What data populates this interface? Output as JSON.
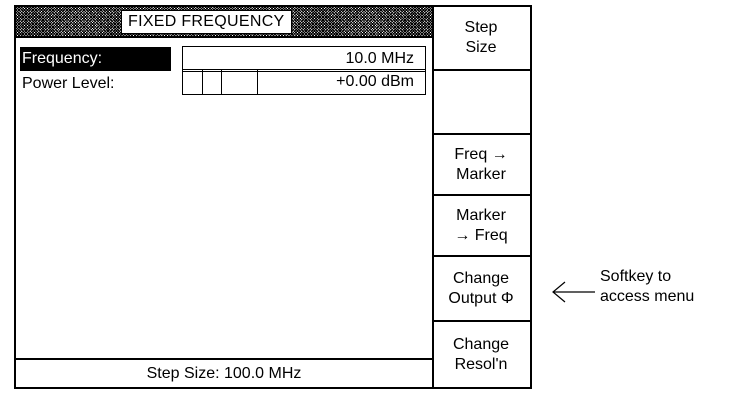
{
  "display": {
    "title": "FIXED FREQUENCY",
    "fields": [
      {
        "label": "Frequency:",
        "value": "10.0 MHz",
        "selected": true
      },
      {
        "label": "Power Level:",
        "value": "+0.00 dBm",
        "selected": false
      }
    ],
    "status": "Step Size: 100.0 MHz"
  },
  "softkeys": [
    {
      "line1": "Step",
      "line2": "Size"
    },
    {
      "line1": "",
      "line2": ""
    },
    {
      "line1": "Freq →",
      "line2": "Marker"
    },
    {
      "line1": "Marker",
      "line2": "→ Freq"
    },
    {
      "line1": "Change",
      "line2": "Output Φ"
    },
    {
      "line1": "Change",
      "line2": "Resol'n"
    }
  ],
  "annotation": {
    "line1": "Softkey to",
    "line2": "access menu",
    "arrow_icon": "left-arrow-icon"
  }
}
